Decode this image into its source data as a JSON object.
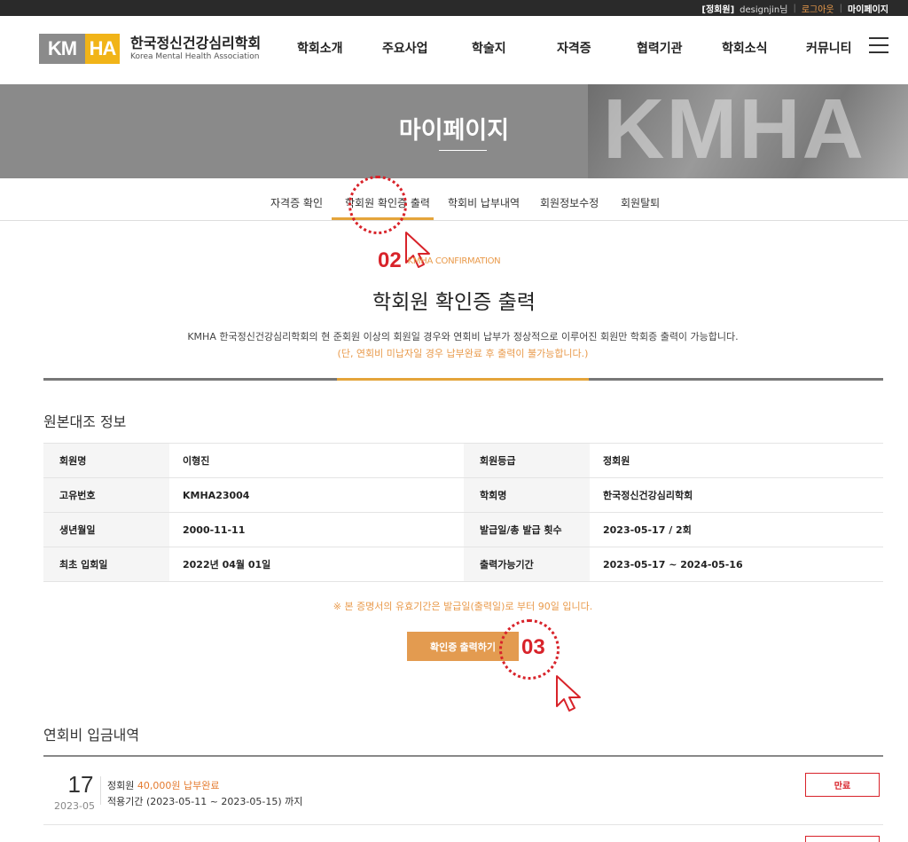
{
  "utility_bar": {
    "grade": "[정회원]",
    "user": "designjin님",
    "sep": "|",
    "logout": "로그아웃",
    "mypage": "마이페이지"
  },
  "logo": {
    "mark_left": "KM",
    "mark_right": "HA",
    "name_ko": "한국정신건강심리학회",
    "name_en": "Korea Mental Health Association"
  },
  "nav": [
    "학회소개",
    "주요사업",
    "학술지",
    "자격증",
    "협력기관",
    "학회소식",
    "커뮤니티"
  ],
  "banner": {
    "title": "마이페이지",
    "bg_letters": "KMHA"
  },
  "subtabs": [
    "자격증 확인",
    "학회원 확인증 출력",
    "학회비 납부내역",
    "회원정보수정",
    "회원탈퇴"
  ],
  "active_subtab": 1,
  "annotations": {
    "step2": "02",
    "step3": "03"
  },
  "section": {
    "eyebrow": "KMHA CONFIRMATION",
    "title": "학회원 확인증 출력",
    "desc": "KMHA 한국정신건강심리학회의 현 준회원 이상의 회원일 경우와 연회비 납부가 정상적으로 이루어진 회원만 학회증 출력이 가능합니다.",
    "desc_note": "(단, 연회비 미납자일 경우 납부완료 후 출력이 불가능합니다.)"
  },
  "info": {
    "title": "원본대조 정보",
    "rows": [
      {
        "l1": "회원명",
        "v1": "이형진",
        "l2": "회원등급",
        "v2": "정회원"
      },
      {
        "l1": "고유번호",
        "v1": "KMHA23004",
        "l2": "학회명",
        "v2": "한국정신건강심리학회"
      },
      {
        "l1": "생년월일",
        "v1": "2000-11-11",
        "l2": "발급일/총 발급 횟수",
        "v2": "2023-05-17 / 2회"
      },
      {
        "l1": "최초 입회일",
        "v1": "2022년 04월 01일",
        "l2": "출력가능기간",
        "v2": "2023-05-17 ~ 2024-05-16"
      }
    ],
    "note": "※ 본 증명서의 유효기간은 발급일(출력일)로 부터 90일 입니다.",
    "print_button": "확인증 출력하기"
  },
  "payments": {
    "title": "연회비 입금내역",
    "items": [
      {
        "day": "17",
        "year_month": "2023-05",
        "grade": "정회원",
        "amount": "40,000원 납부완료",
        "period": "적용기간 (2023-05-11 ~ 2023-05-15) 까지",
        "status": "만료"
      }
    ]
  },
  "colors": {
    "accent": "#e4a43a",
    "orange_text": "#e99a4b",
    "annotation_red": "#d8232a",
    "button": "#e39b50"
  }
}
